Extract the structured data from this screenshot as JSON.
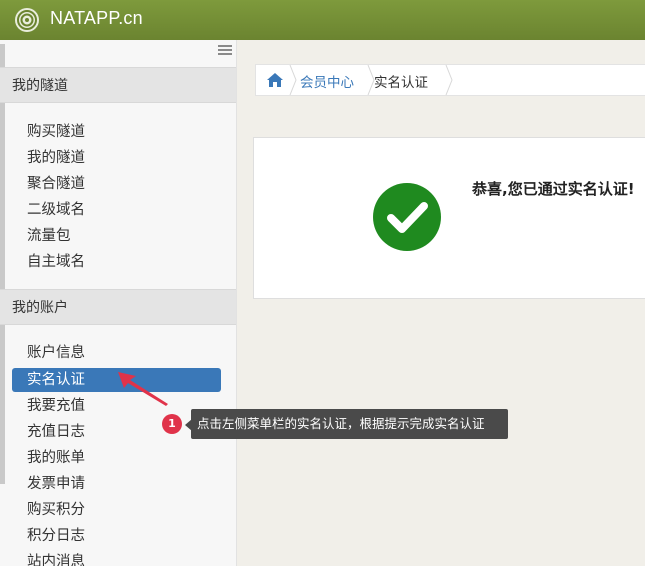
{
  "header": {
    "brand": "NATAPP.cn",
    "logo_icon": "spiral-logo-icon"
  },
  "sidebar": {
    "sections": [
      {
        "title": "我的隧道",
        "items": [
          "购买隧道",
          "我的隧道",
          "聚合隧道",
          "二级域名",
          "流量包",
          "自主域名"
        ]
      },
      {
        "title": "我的账户",
        "items": [
          "账户信息",
          "实名认证",
          "我要充值",
          "充值日志",
          "我的账单",
          "发票申请",
          "购买积分",
          "积分日志",
          "站内消息"
        ]
      }
    ],
    "active_item": "实名认证",
    "active_color": "#3a78b8"
  },
  "breadcrumb": {
    "home_icon": "home-icon",
    "link": "会员中心",
    "current": "实名认证"
  },
  "card": {
    "success_text": "恭喜,您已通过实名认证!",
    "icon": "check-circle-icon",
    "icon_color": "#1f8a1f"
  },
  "annotation": {
    "step": "1",
    "tip": "点击左侧菜单栏的实名认证，根据提示完成实名认证",
    "badge_color": "#e0334a"
  }
}
